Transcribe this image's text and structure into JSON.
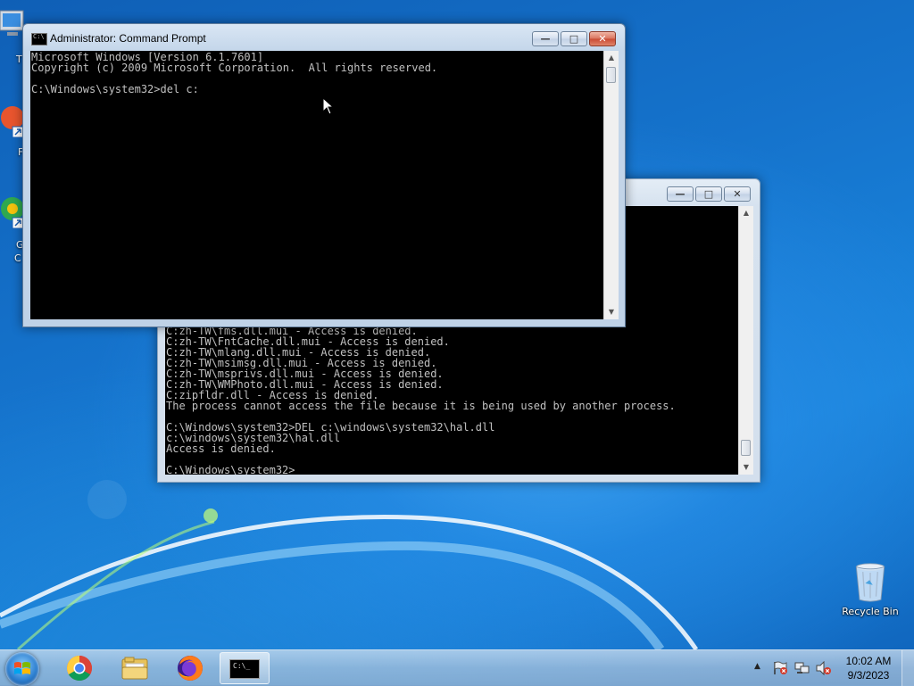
{
  "desktop": {
    "recycle_bin_label": "Recycle Bin",
    "partial_labels": [
      "T",
      "F",
      "G",
      "C"
    ]
  },
  "front_window": {
    "title": "Administrator: Command Prompt",
    "icon_text": "C:\\",
    "lines": [
      "Microsoft Windows [Version 6.1.7601]",
      "Copyright (c) 2009 Microsoft Corporation.  All rights reserved.",
      "",
      "C:\\Windows\\system32>del c:"
    ]
  },
  "back_window": {
    "lines": [
      "C:zh-TW\\fms.dll.mui - Access is denied.",
      "C:zh-TW\\FntCache.dll.mui - Access is denied.",
      "C:zh-TW\\mlang.dll.mui - Access is denied.",
      "C:zh-TW\\msimsg.dll.mui - Access is denied.",
      "C:zh-TW\\msprivs.dll.mui - Access is denied.",
      "C:zh-TW\\WMPhoto.dll.mui - Access is denied.",
      "C:zipfldr.dll - Access is denied.",
      "The process cannot access the file because it is being used by another process.",
      "",
      "C:\\Windows\\system32>DEL c:\\windows\\system32\\hal.dll",
      "c:\\windows\\system32\\hal.dll",
      "Access is denied.",
      "",
      "C:\\Windows\\system32>"
    ]
  },
  "window_controls": {
    "minimize": "—",
    "maximize": "□",
    "close": "✕"
  },
  "taskbar": {
    "pinned": [
      "Google Chrome",
      "Windows Explorer",
      "Firefox",
      "Command Prompt"
    ],
    "cmd_icon_text": "C:\\_",
    "tray_arrow": "▲",
    "time": "10:02 AM",
    "date": "9/3/2023"
  },
  "colors": {
    "console_bg": "#000000",
    "console_fg": "#c0c0c0",
    "desktop_blue": "#1573cc"
  }
}
